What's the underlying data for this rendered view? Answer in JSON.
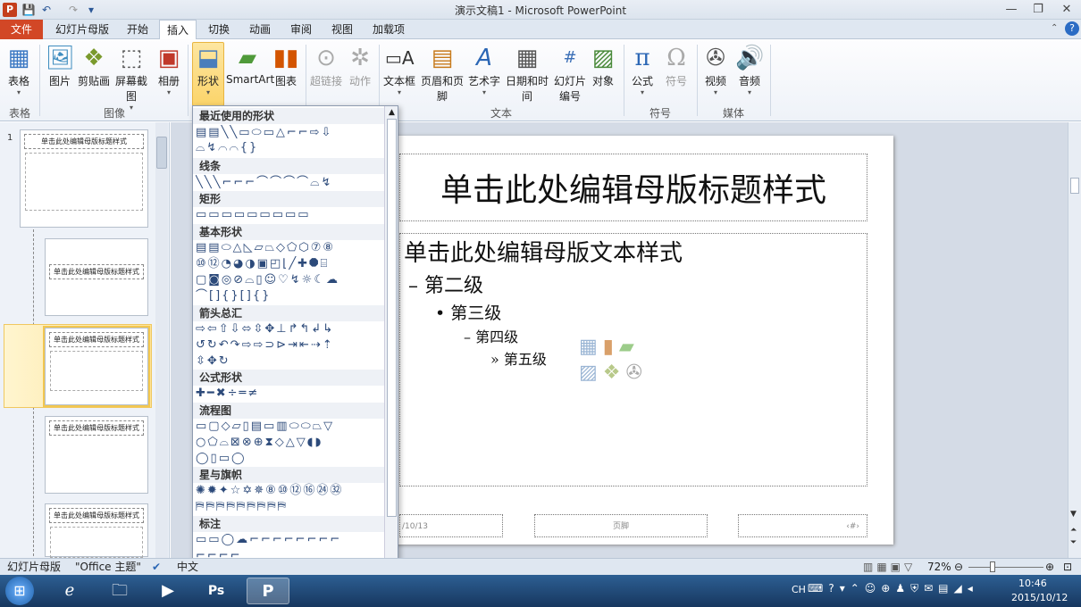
{
  "window": {
    "title": "演示文稿1 - Microsoft PowerPoint",
    "app_logo": "P"
  },
  "tabs": [
    {
      "label": "文件"
    },
    {
      "label": "幻灯片母版"
    },
    {
      "label": "开始"
    },
    {
      "label": "插入"
    },
    {
      "label": "切换"
    },
    {
      "label": "动画"
    },
    {
      "label": "审阅"
    },
    {
      "label": "视图"
    },
    {
      "label": "加载项"
    }
  ],
  "ribbon": {
    "buttons": {
      "table": "表格",
      "picture": "图片",
      "clipart": "剪贴画",
      "screenshot": "屏幕截图",
      "album": "相册",
      "shapes": "形状",
      "smartart": "SmartArt",
      "chart": "图表",
      "hyperlink": "超链接",
      "action": "动作",
      "textbox": "文本框",
      "header": "页眉和页脚",
      "wordart": "艺术字",
      "datetime": "日期和时间",
      "slidenum1": "幻灯片",
      "slidenum2": "编号",
      "object": "对象",
      "equation": "公式",
      "symbol": "符号",
      "video": "视频",
      "audio": "音频"
    },
    "groups": {
      "table": "表格",
      "image": "图像",
      "text": "文本",
      "symbol": "符号",
      "media": "媒体"
    }
  },
  "shapes_menu": {
    "sections": {
      "recent": "最近使用的形状",
      "lines": "线条",
      "rect": "矩形",
      "basic": "基本形状",
      "arrows": "箭头总汇",
      "equation": "公式形状",
      "flowchart": "流程图",
      "stars": "星与旗帜",
      "callouts": "标注"
    }
  },
  "thumbs": {
    "num1": "1",
    "title": "单击此处编辑母版标题样式"
  },
  "slide": {
    "title": "单击此处编辑母版标题样式",
    "level1": "单击此处编辑母版文本样式",
    "level2": "第二级",
    "level3": "第三级",
    "level4": "第四级",
    "level5": "第五级",
    "footer_date": "/10/13",
    "footer_text": "页脚",
    "footer_num": "‹#›"
  },
  "status": {
    "view": "幻灯片母版",
    "theme": "\"Office 主题\"",
    "lang": "中文",
    "zoom": "72%"
  },
  "taskbar": {
    "ime": "CH",
    "time": "10:46",
    "date": "2015/10/12"
  }
}
